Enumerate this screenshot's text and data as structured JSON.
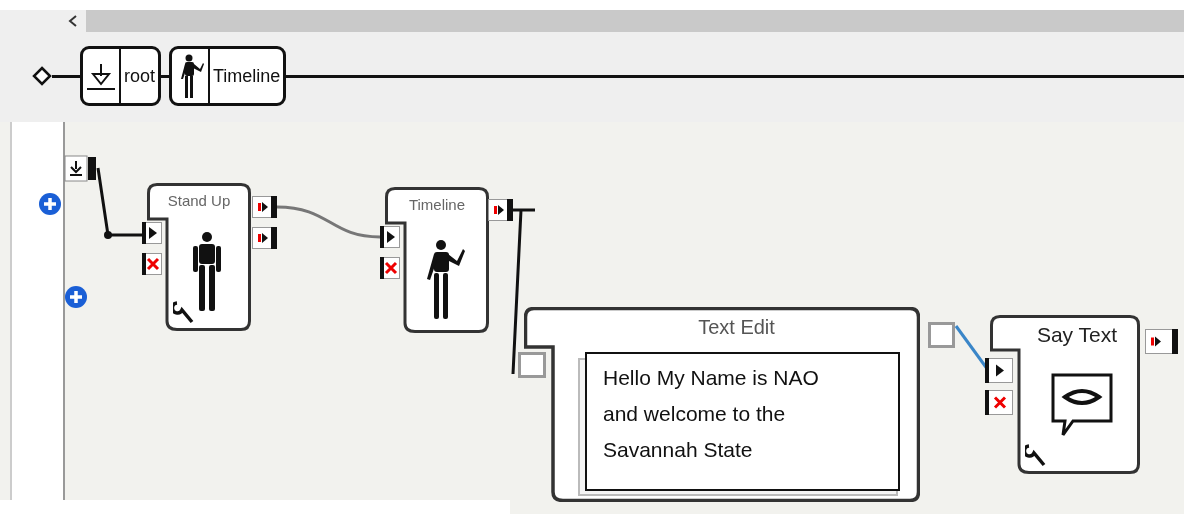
{
  "breadcrumb": [
    {
      "label": "root",
      "kind": "root"
    },
    {
      "label": "Timeline",
      "kind": "timeline"
    }
  ],
  "boxes": [
    {
      "title": "Stand Up",
      "kind": "stand"
    },
    {
      "title": "Timeline",
      "kind": "timeline"
    },
    {
      "title": "Say Text",
      "kind": "say"
    }
  ],
  "text_edit": {
    "title": "Text Edit",
    "lines": [
      "Hello My Name is NAO",
      "and welcome to the",
      "Savannah State"
    ]
  }
}
